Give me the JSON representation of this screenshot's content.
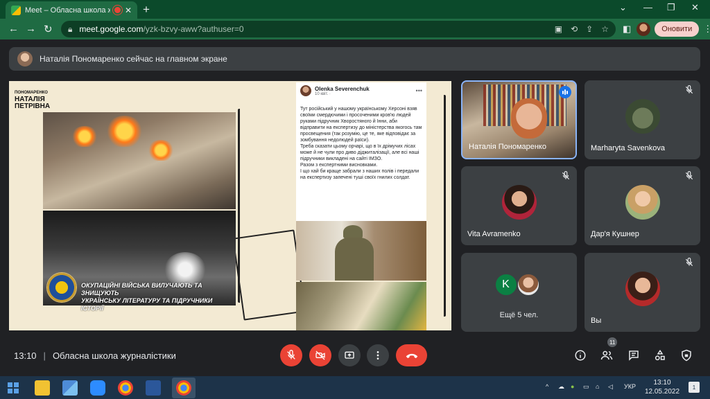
{
  "browser": {
    "tab_title": "Meet – Обласна школа жур",
    "url_main": "meet.google.com",
    "url_rest": "/yzk-bzvy-aww?authuser=0",
    "update_label": "Оновити"
  },
  "banner": {
    "text": "Наталія Пономаренко сейчас на главном экране"
  },
  "presentation": {
    "logo_small": "ПОНОМАРЕНКО",
    "logo_line1": "НАТАЛІЯ",
    "logo_line2": "ПЕТРІВНА",
    "caption_line1": "Окупаційні війська вилучають та знищують",
    "caption_line2": "українську літературу та підручники історії",
    "post": {
      "author": "Olenka Severenchuk",
      "date": "10 квіт. · ",
      "paragraphs": [
        "Тут російський                    у нашому українському Херсоні взяв своїми смердючими і просоченими кров'ю людей руками підручник Хворостяного й Інни, аби відправити на експертизу до міністерства якогось там просвещения (так розумію, це те, яке відповідає за зомбування недолюдей раїси).",
        "Треба сказати цьому орчарі, що в їх дрімучих лісах може й не чули про диво діджиталізації, але всі наші підручники викладені на сайті ІМЗО.",
        "Разом з експертними висновками.",
        "І що хай би краще забрали з наших полів і передали на експертизу запечені туші своїх гнилих солдат."
      ]
    }
  },
  "participants": [
    {
      "name": "Наталія Пономаренко",
      "muted": false,
      "speaking": true
    },
    {
      "name": "Marharyta Savenkova",
      "muted": true
    },
    {
      "name": "Vita Avramenko",
      "muted": true
    },
    {
      "name": "Дар'я Кушнер",
      "muted": true
    },
    {
      "name": "Ещё 5 чел.",
      "initial": "K"
    },
    {
      "name": "Вы",
      "muted": true
    }
  ],
  "meeting": {
    "time": "13:10",
    "separator": "|",
    "title": "Обласна школа журналістики",
    "participant_count": "11"
  },
  "taskbar": {
    "lang": "УКР",
    "clock_time": "13:10",
    "clock_date": "12.05.2022",
    "notifications": "1"
  },
  "colors": {
    "accent": "#1a73e8",
    "danger": "#ea4335",
    "tile_bg": "#3c4043",
    "page_bg": "#202124",
    "chrome_theme": "#1f6b43"
  },
  "icons": [
    "chrome-icon",
    "back-icon",
    "forward-icon",
    "reload-icon",
    "lock-icon",
    "camera-icon",
    "translate-icon",
    "share-icon",
    "star-icon",
    "sidebar-icon",
    "mic-off-icon",
    "camera-off-icon",
    "present-icon",
    "more-vert-icon",
    "hangup-icon",
    "info-icon",
    "people-icon",
    "chat-icon",
    "activities-icon",
    "host-controls-icon",
    "windows-start-icon"
  ]
}
